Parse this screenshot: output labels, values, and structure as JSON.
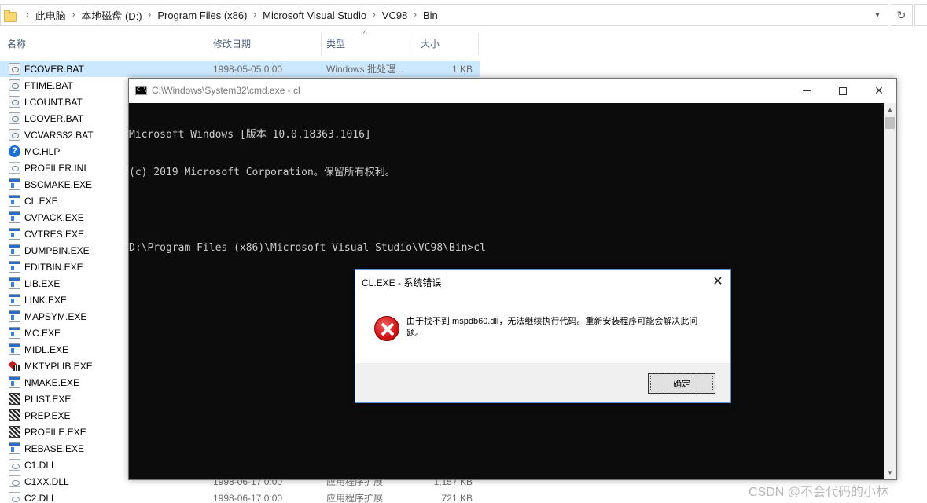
{
  "explorer": {
    "breadcrumbs": [
      "此电脑",
      "本地磁盘 (D:)",
      "Program Files (x86)",
      "Microsoft Visual Studio",
      "VC98",
      "Bin"
    ],
    "columns": {
      "name": "名称",
      "date": "修改日期",
      "type": "类型",
      "size": "大小"
    },
    "files": [
      {
        "name": "FCOVER.BAT",
        "date": "1998-05-05 0:00",
        "type": "Windows 批处理...",
        "size": "1 KB",
        "icon": "batch-file-icon",
        "selected": true
      },
      {
        "name": "FTIME.BAT",
        "date": "",
        "type": "",
        "size": "",
        "icon": "batch-file-icon"
      },
      {
        "name": "LCOUNT.BAT",
        "date": "",
        "type": "",
        "size": "",
        "icon": "batch-file-icon"
      },
      {
        "name": "LCOVER.BAT",
        "date": "",
        "type": "",
        "size": "",
        "icon": "batch-file-icon"
      },
      {
        "name": "VCVARS32.BAT",
        "date": "",
        "type": "",
        "size": "",
        "icon": "batch-file-icon"
      },
      {
        "name": "MC.HLP",
        "date": "",
        "type": "",
        "size": "",
        "icon": "help-file-icon"
      },
      {
        "name": "PROFILER.INI",
        "date": "",
        "type": "",
        "size": "",
        "icon": "ini-file-icon"
      },
      {
        "name": "BSCMAKE.EXE",
        "date": "",
        "type": "",
        "size": "",
        "icon": "exe-file-icon"
      },
      {
        "name": "CL.EXE",
        "date": "",
        "type": "",
        "size": "",
        "icon": "exe-file-icon"
      },
      {
        "name": "CVPACK.EXE",
        "date": "",
        "type": "",
        "size": "",
        "icon": "exe-file-icon"
      },
      {
        "name": "CVTRES.EXE",
        "date": "",
        "type": "",
        "size": "",
        "icon": "exe-file-icon"
      },
      {
        "name": "DUMPBIN.EXE",
        "date": "",
        "type": "",
        "size": "",
        "icon": "exe-file-icon"
      },
      {
        "name": "EDITBIN.EXE",
        "date": "",
        "type": "",
        "size": "",
        "icon": "exe-file-icon"
      },
      {
        "name": "LIB.EXE",
        "date": "",
        "type": "",
        "size": "",
        "icon": "exe-file-icon"
      },
      {
        "name": "LINK.EXE",
        "date": "",
        "type": "",
        "size": "",
        "icon": "exe-file-icon"
      },
      {
        "name": "MAPSYM.EXE",
        "date": "",
        "type": "",
        "size": "",
        "icon": "exe-file-icon"
      },
      {
        "name": "MC.EXE",
        "date": "",
        "type": "",
        "size": "",
        "icon": "exe-file-icon"
      },
      {
        "name": "MIDL.EXE",
        "date": "",
        "type": "",
        "size": "",
        "icon": "exe-file-icon"
      },
      {
        "name": "MKTYPLIB.EXE",
        "date": "",
        "type": "",
        "size": "",
        "icon": "mktyplib-app-icon"
      },
      {
        "name": "NMAKE.EXE",
        "date": "",
        "type": "",
        "size": "",
        "icon": "exe-file-icon"
      },
      {
        "name": "PLIST.EXE",
        "date": "",
        "type": "",
        "size": "",
        "icon": "legacy-app-icon"
      },
      {
        "name": "PREP.EXE",
        "date": "",
        "type": "",
        "size": "",
        "icon": "legacy-app-icon"
      },
      {
        "name": "PROFILE.EXE",
        "date": "",
        "type": "",
        "size": "",
        "icon": "legacy-app-icon"
      },
      {
        "name": "REBASE.EXE",
        "date": "",
        "type": "",
        "size": "",
        "icon": "exe-file-icon"
      },
      {
        "name": "C1.DLL",
        "date": "",
        "type": "",
        "size": "",
        "icon": "dll-file-icon"
      },
      {
        "name": "C1XX.DLL",
        "date": "1998-06-17 0:00",
        "type": "应用程序扩展",
        "size": "1,157 KB",
        "icon": "dll-file-icon"
      },
      {
        "name": "C2.DLL",
        "date": "1998-06-17 0:00",
        "type": "应用程序扩展",
        "size": "721 KB",
        "icon": "dll-file-icon"
      }
    ]
  },
  "cmd": {
    "title": "C:\\Windows\\System32\\cmd.exe - cl",
    "lines": [
      "Microsoft Windows [版本 10.0.18363.1016]",
      "(c) 2019 Microsoft Corporation。保留所有权利。",
      "",
      "D:\\Program Files (x86)\\Microsoft Visual Studio\\VC98\\Bin>cl"
    ]
  },
  "dialog": {
    "title": "CL.EXE - 系统错误",
    "message": "由于找不到 mspdb60.dll，无法继续执行代码。重新安装程序可能会解决此问题。",
    "ok_label": "确定"
  },
  "watermark": "CSDN @不会代码的小林"
}
